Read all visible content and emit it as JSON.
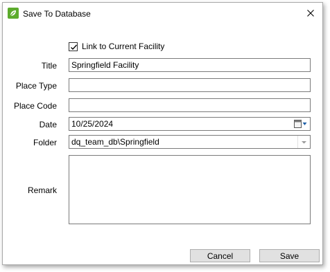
{
  "window": {
    "title": "Save To Database"
  },
  "icons": {
    "app": "app-leaf-icon",
    "close": "close-icon",
    "calendar": "calendar-icon",
    "dropdown": "chevron-down-icon"
  },
  "form": {
    "link_checkbox": {
      "label": "Link to Current Facility",
      "checked": true
    },
    "title": {
      "label": "Title",
      "value": "Springfield Facility"
    },
    "place_type": {
      "label": "Place Type",
      "value": ""
    },
    "place_code": {
      "label": "Place Code",
      "value": ""
    },
    "date": {
      "label": "Date",
      "value": "10/25/2024"
    },
    "folder": {
      "label": "Folder",
      "value": "dq_team_db\\Springfield"
    },
    "remark": {
      "label": "Remark",
      "value": ""
    }
  },
  "buttons": {
    "cancel": "Cancel",
    "save": "Save"
  },
  "colors": {
    "app_icon": "#5cab2c",
    "button_face": "#e1e1e1",
    "dropdown_arrow": "#1e5fa8"
  }
}
